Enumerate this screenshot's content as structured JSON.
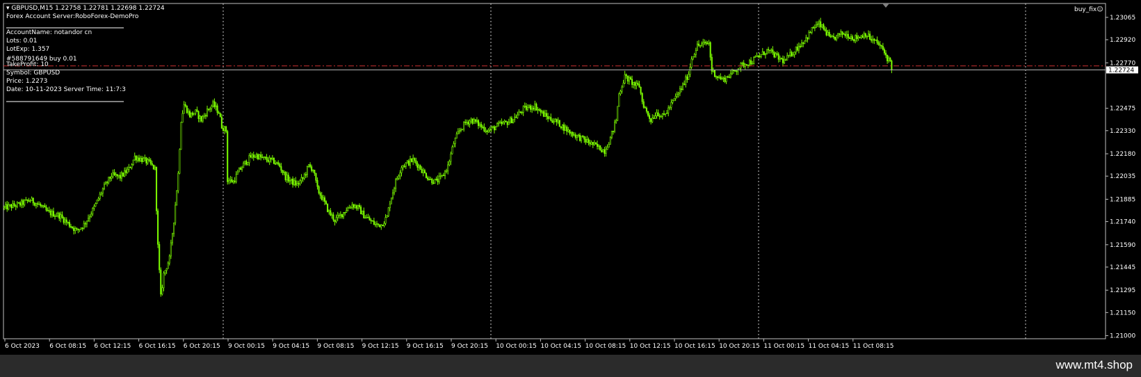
{
  "header": {
    "symbol_line": "GBPUSD,M15  1.22758 1.22781 1.22698 1.22724",
    "server_line": "Forex Account Server:RoboForex-DemoPro"
  },
  "info_panel": {
    "account": "AccountName:  notandor cn",
    "lots": "Lots:  0.01",
    "lotexp": "LotExp:  1.357",
    "order_line": "#588791649 buy 0.01",
    "takeprofit": "TakeProfit:  10",
    "symbol": "Symbol: GBPUSD",
    "price": "Price:  1.2273",
    "date": "Date: 10-11-2023 Server Time: 11:7:3"
  },
  "ea_name": "buy_fix",
  "smiley_icon": "smiley-icon",
  "watermark": "www.mt4.shop",
  "colors": {
    "background": "#000000",
    "candle": "#7cfc00",
    "grid": "#c8c8c8",
    "order_line": "#cc3030",
    "bid_line": "#b0b0b0",
    "bottom_bar": "#2b2b2b"
  },
  "chart_data": {
    "type": "candlestick",
    "symbol": "GBPUSD",
    "timeframe": "M15",
    "last_ohlc": [
      1.22758,
      1.22781,
      1.22698,
      1.22724
    ],
    "current_price": 1.22724,
    "price_label": "1.22724",
    "order_price": 1.2275,
    "ylim": [
      1.2098,
      1.23155
    ],
    "y_ticks": [
      "1.23065",
      "1.22920",
      "1.22770",
      "1.22475",
      "1.22330",
      "1.22180",
      "1.22035",
      "1.21885",
      "1.21740",
      "1.21590",
      "1.21445",
      "1.21295",
      "1.21150",
      "1.21000"
    ],
    "x_ticks": [
      "6 Oct 2023",
      "6 Oct 08:15",
      "6 Oct 12:15",
      "6 Oct 16:15",
      "6 Oct 20:15",
      "9 Oct 00:15",
      "9 Oct 04:15",
      "9 Oct 08:15",
      "9 Oct 12:15",
      "9 Oct 16:15",
      "9 Oct 20:15",
      "10 Oct 00:15",
      "10 Oct 04:15",
      "10 Oct 08:15",
      "10 Oct 12:15",
      "10 Oct 16:15",
      "10 Oct 20:15",
      "11 Oct 00:15",
      "11 Oct 04:15",
      "11 Oct 08:15"
    ],
    "day_separators": [
      "9 Oct",
      "10 Oct",
      "11 Oct",
      "12 Oct"
    ],
    "close_path": [
      [
        0,
        1.2183
      ],
      [
        10,
        1.2185
      ],
      [
        18,
        1.2188
      ],
      [
        24,
        1.2185
      ],
      [
        30,
        1.218
      ],
      [
        38,
        1.2178
      ],
      [
        45,
        1.2172
      ],
      [
        50,
        1.2168
      ],
      [
        55,
        1.2172
      ],
      [
        62,
        1.2183
      ],
      [
        68,
        1.2195
      ],
      [
        74,
        1.2204
      ],
      [
        80,
        1.2203
      ],
      [
        86,
        1.2208
      ],
      [
        90,
        1.2216
      ],
      [
        96,
        1.2214
      ],
      [
        100,
        1.2212
      ],
      [
        104,
        1.2208
      ],
      [
        106,
        1.2158
      ],
      [
        108,
        1.2125
      ],
      [
        110,
        1.214
      ],
      [
        114,
        1.215
      ],
      [
        117,
        1.2175
      ],
      [
        120,
        1.2205
      ],
      [
        122,
        1.224
      ],
      [
        124,
        1.225
      ],
      [
        128,
        1.2243
      ],
      [
        132,
        1.2245
      ],
      [
        136,
        1.224
      ],
      [
        140,
        1.2246
      ],
      [
        144,
        1.225
      ],
      [
        148,
        1.2245
      ],
      [
        150,
        1.2236
      ],
      [
        153,
        1.2233
      ],
      [
        154,
        1.2201
      ],
      [
        158,
        1.22
      ],
      [
        162,
        1.2207
      ],
      [
        166,
        1.2212
      ],
      [
        170,
        1.2216
      ],
      [
        174,
        1.2217
      ],
      [
        178,
        1.2215
      ],
      [
        182,
        1.2214
      ],
      [
        186,
        1.2213
      ],
      [
        190,
        1.221
      ],
      [
        194,
        1.2203
      ],
      [
        198,
        1.22
      ],
      [
        202,
        1.2198
      ],
      [
        206,
        1.2202
      ],
      [
        210,
        1.221
      ],
      [
        213,
        1.2208
      ],
      [
        216,
        1.2195
      ],
      [
        220,
        1.2188
      ],
      [
        224,
        1.218
      ],
      [
        228,
        1.2175
      ],
      [
        232,
        1.2178
      ],
      [
        236,
        1.2182
      ],
      [
        240,
        1.2185
      ],
      [
        244,
        1.2183
      ],
      [
        248,
        1.2178
      ],
      [
        252,
        1.2175
      ],
      [
        256,
        1.2172
      ],
      [
        260,
        1.2172
      ],
      [
        264,
        1.2177
      ],
      [
        266,
        1.2187
      ],
      [
        270,
        1.22
      ],
      [
        274,
        1.221
      ],
      [
        278,
        1.2212
      ],
      [
        282,
        1.2214
      ],
      [
        286,
        1.221
      ],
      [
        290,
        1.2205
      ],
      [
        294,
        1.2201
      ],
      [
        298,
        1.22
      ],
      [
        302,
        1.2203
      ],
      [
        306,
        1.221
      ],
      [
        310,
        1.2225
      ],
      [
        314,
        1.2233
      ],
      [
        318,
        1.2238
      ],
      [
        322,
        1.224
      ],
      [
        326,
        1.2238
      ],
      [
        330,
        1.2235
      ],
      [
        334,
        1.2233
      ],
      [
        338,
        1.2235
      ],
      [
        342,
        1.2237
      ],
      [
        346,
        1.2238
      ],
      [
        350,
        1.224
      ],
      [
        354,
        1.2243
      ],
      [
        358,
        1.2247
      ],
      [
        362,
        1.2248
      ],
      [
        366,
        1.2249
      ],
      [
        370,
        1.2245
      ],
      [
        374,
        1.2242
      ],
      [
        378,
        1.224
      ],
      [
        382,
        1.2238
      ],
      [
        386,
        1.2235
      ],
      [
        390,
        1.2232
      ],
      [
        394,
        1.223
      ],
      [
        398,
        1.2228
      ],
      [
        402,
        1.2226
      ],
      [
        406,
        1.2224
      ],
      [
        410,
        1.2222
      ],
      [
        414,
        1.222
      ],
      [
        418,
        1.2228
      ],
      [
        422,
        1.224
      ],
      [
        424,
        1.2257
      ],
      [
        428,
        1.2268
      ],
      [
        432,
        1.2265
      ],
      [
        436,
        1.2262
      ],
      [
        438,
        1.2262
      ],
      [
        440,
        1.2252
      ],
      [
        443,
        1.2245
      ],
      [
        446,
        1.224
      ],
      [
        450,
        1.2245
      ],
      [
        454,
        1.2242
      ],
      [
        456,
        1.2244
      ],
      [
        460,
        1.225
      ],
      [
        464,
        1.2256
      ],
      [
        468,
        1.2262
      ],
      [
        472,
        1.227
      ],
      [
        474,
        1.228
      ],
      [
        478,
        1.2288
      ],
      [
        482,
        1.2289
      ],
      [
        486,
        1.229
      ],
      [
        488,
        1.2272
      ],
      [
        492,
        1.2268
      ],
      [
        496,
        1.2266
      ],
      [
        500,
        1.2269
      ],
      [
        504,
        1.2272
      ],
      [
        508,
        1.2275
      ],
      [
        512,
        1.2277
      ],
      [
        516,
        1.2278
      ],
      [
        518,
        1.228
      ],
      [
        522,
        1.2282
      ],
      [
        526,
        1.2285
      ],
      [
        530,
        1.2283
      ],
      [
        534,
        1.228
      ],
      [
        538,
        1.2278
      ],
      [
        542,
        1.2282
      ],
      [
        546,
        1.2286
      ],
      [
        550,
        1.229
      ],
      [
        554,
        1.2294
      ],
      [
        558,
        1.23
      ],
      [
        562,
        1.2302
      ],
      [
        566,
        1.2298
      ],
      [
        570,
        1.2292
      ],
      [
        574,
        1.2294
      ],
      [
        578,
        1.2296
      ],
      [
        582,
        1.2295
      ],
      [
        586,
        1.2293
      ],
      [
        590,
        1.2294
      ],
      [
        594,
        1.2296
      ],
      [
        598,
        1.2292
      ],
      [
        602,
        1.229
      ],
      [
        604,
        1.2288
      ],
      [
        606,
        1.2285
      ],
      [
        608,
        1.2282
      ],
      [
        609,
        1.228
      ],
      [
        611,
        1.2278
      ],
      [
        612,
        1.22724
      ]
    ]
  }
}
